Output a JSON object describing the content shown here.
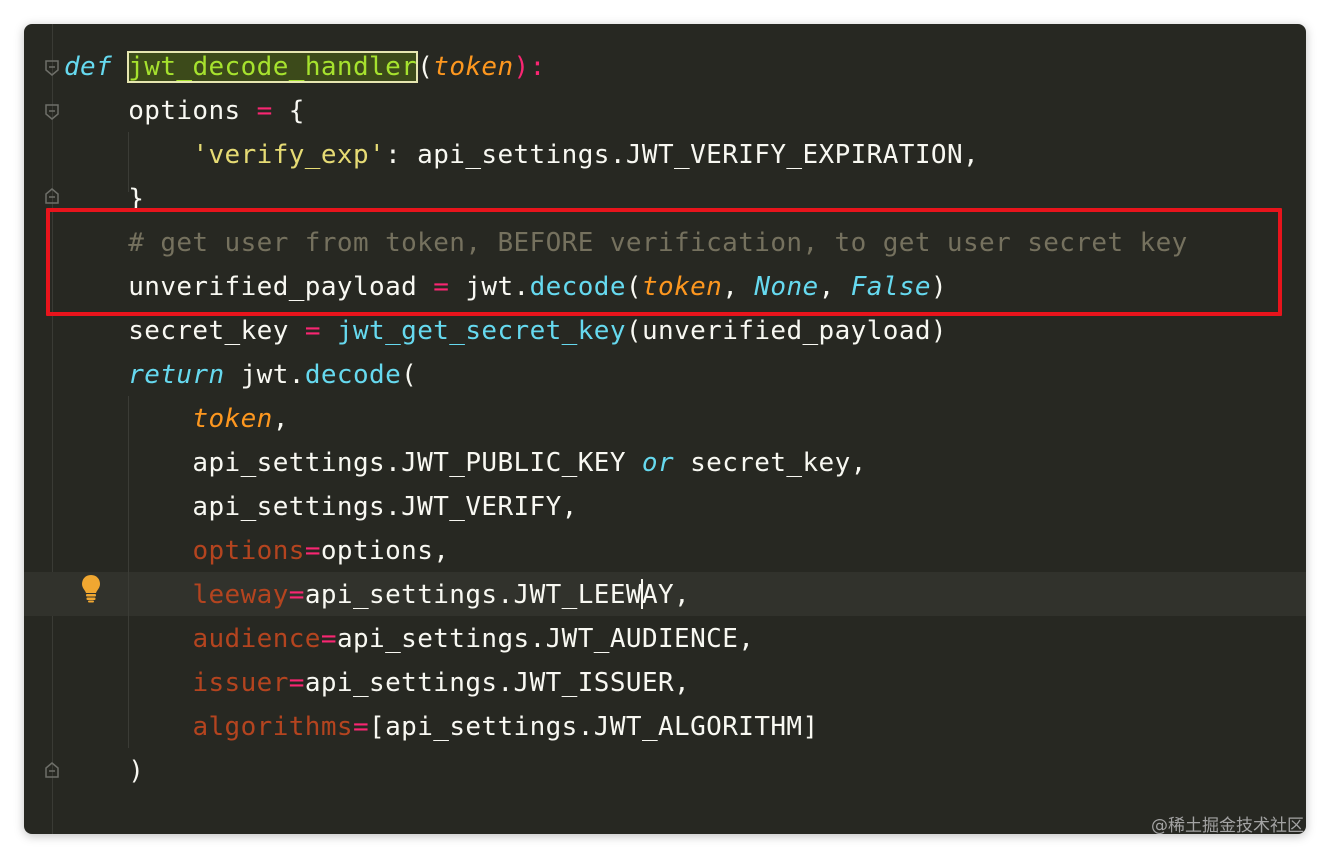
{
  "editor": {
    "lines": [
      [
        {
          "t": "def",
          "c": "kw"
        },
        {
          "t": " ",
          "c": ""
        },
        {
          "t": "jwt_decode_handler",
          "c": "fn-hl"
        },
        {
          "t": "(",
          "c": ""
        },
        {
          "t": "token",
          "c": "param"
        },
        {
          "t": "):",
          "c": "op"
        }
      ],
      [
        {
          "t": "    options ",
          "c": ""
        },
        {
          "t": "=",
          "c": "op"
        },
        {
          "t": " {",
          "c": ""
        }
      ],
      [
        {
          "t": "        ",
          "c": ""
        },
        {
          "t": "'verify_exp'",
          "c": "str"
        },
        {
          "t": ": api_settings.JWT_VERIFY_EXPIRATION,",
          "c": ""
        }
      ],
      [
        {
          "t": "    }",
          "c": ""
        }
      ],
      [
        {
          "t": "    # get user from token, BEFORE verification, to get user secret key",
          "c": "cmt"
        }
      ],
      [
        {
          "t": "    unverified_payload ",
          "c": ""
        },
        {
          "t": "=",
          "c": "op"
        },
        {
          "t": " jwt.",
          "c": ""
        },
        {
          "t": "decode",
          "c": "call"
        },
        {
          "t": "(",
          "c": ""
        },
        {
          "t": "token",
          "c": "param"
        },
        {
          "t": ", ",
          "c": ""
        },
        {
          "t": "None",
          "c": "const"
        },
        {
          "t": ", ",
          "c": ""
        },
        {
          "t": "False",
          "c": "const"
        },
        {
          "t": ")",
          "c": ""
        }
      ],
      [
        {
          "t": "    secret_key ",
          "c": ""
        },
        {
          "t": "=",
          "c": "op"
        },
        {
          "t": " ",
          "c": ""
        },
        {
          "t": "jwt_get_secret_key",
          "c": "call"
        },
        {
          "t": "(unverified_payload)",
          "c": ""
        }
      ],
      [
        {
          "t": "    ",
          "c": ""
        },
        {
          "t": "return",
          "c": "kw"
        },
        {
          "t": " jwt.",
          "c": ""
        },
        {
          "t": "decode",
          "c": "call"
        },
        {
          "t": "(",
          "c": ""
        }
      ],
      [
        {
          "t": "        ",
          "c": ""
        },
        {
          "t": "token",
          "c": "param"
        },
        {
          "t": ",",
          "c": ""
        }
      ],
      [
        {
          "t": "        api_settings.JWT_PUBLIC_KEY ",
          "c": ""
        },
        {
          "t": "or",
          "c": "kw"
        },
        {
          "t": " secret_key,",
          "c": ""
        }
      ],
      [
        {
          "t": "        api_settings.JWT_VERIFY,",
          "c": ""
        }
      ],
      [
        {
          "t": "        ",
          "c": ""
        },
        {
          "t": "options",
          "c": "kwarg"
        },
        {
          "t": "=",
          "c": "op"
        },
        {
          "t": "options,",
          "c": ""
        }
      ],
      [
        {
          "t": "        ",
          "c": ""
        },
        {
          "t": "leeway",
          "c": "kwarg"
        },
        {
          "t": "=",
          "c": "op"
        },
        {
          "t": "api_settings.JWT_LEEW",
          "c": ""
        },
        {
          "t": "|",
          "c": "cursor"
        },
        {
          "t": "AY,",
          "c": ""
        }
      ],
      [
        {
          "t": "        ",
          "c": ""
        },
        {
          "t": "audience",
          "c": "kwarg"
        },
        {
          "t": "=",
          "c": "op"
        },
        {
          "t": "api_settings.JWT_AUDIENCE,",
          "c": ""
        }
      ],
      [
        {
          "t": "        ",
          "c": ""
        },
        {
          "t": "issuer",
          "c": "kwarg"
        },
        {
          "t": "=",
          "c": "op"
        },
        {
          "t": "api_settings.JWT_ISSUER,",
          "c": ""
        }
      ],
      [
        {
          "t": "        ",
          "c": ""
        },
        {
          "t": "algorithms",
          "c": "kwarg"
        },
        {
          "t": "=",
          "c": "op"
        },
        {
          "t": "[api_settings.JWT_ALGORITHM]",
          "c": ""
        }
      ],
      [
        {
          "t": "    )",
          "c": ""
        }
      ]
    ]
  },
  "highlight_box": {
    "color": "#e8141c",
    "lines": [
      5,
      6
    ]
  },
  "intention_bulb_line": 13,
  "watermark": "@稀土掘金技术社区",
  "colors": {
    "background": "#272822",
    "keyword": "#66d9ef",
    "function": "#a6e22e",
    "param": "#fd971f",
    "operator": "#f92672",
    "string": "#e6db74",
    "comment": "#75715e",
    "kwarg": "#b4441f"
  }
}
